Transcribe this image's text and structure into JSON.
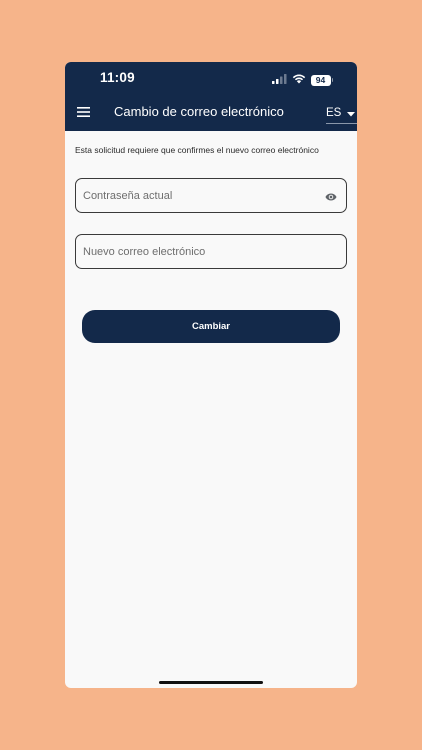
{
  "status_bar": {
    "time": "11:09",
    "battery_level": "94",
    "icons": [
      "signal-icon",
      "wifi-icon",
      "battery-icon"
    ]
  },
  "app_bar": {
    "menu_icon": "hamburger-menu-icon",
    "title": "Cambio de correo electrónico",
    "language": {
      "selected": "ES",
      "caret_icon": "caret-down-icon"
    }
  },
  "form": {
    "notice": "Esta solicitud requiere que confirmes el nuevo correo electrónico",
    "current_password": {
      "placeholder": "Contraseña actual",
      "value": "",
      "toggle_icon": "eye-icon"
    },
    "new_email": {
      "placeholder": "Nuevo correo electrónico",
      "value": ""
    },
    "submit_label": "Cambiar"
  },
  "colors": {
    "page_background": "#F6B48A",
    "header_background": "#13294A",
    "content_background": "#F9F9F9",
    "button_background": "#13294A",
    "button_text": "#FFFFFF"
  }
}
